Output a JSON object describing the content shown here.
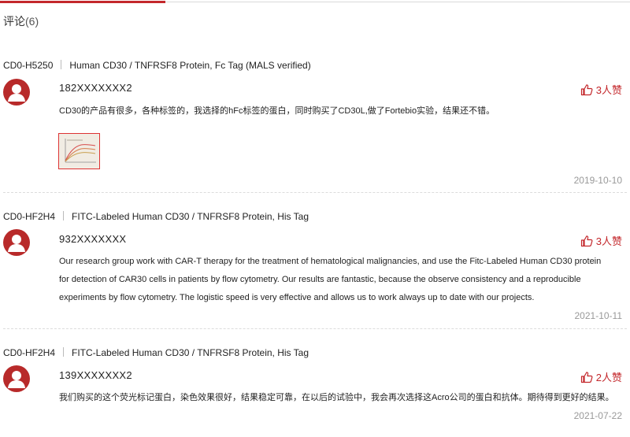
{
  "header": {
    "title": "评论",
    "count": "(6)"
  },
  "reviews": [
    {
      "code": "CD0-H5250",
      "product": "Human CD30 / TNFRSF8 Protein, Fc Tag (MALS verified)",
      "user": "182XXXXXXX2",
      "likes": "3人赞",
      "text": "CD30的产品有很多，各种标签的，我选择的hFc标签的蛋白，同时购买了CD30L,做了Fortebio实验，结果还不错。",
      "date": "2019-10-10"
    },
    {
      "code": "CD0-HF2H4",
      "product": "FITC-Labeled Human CD30 / TNFRSF8 Protein, His Tag",
      "user": "932XXXXXXX",
      "likes": "3人赞",
      "text_lines": [
        "Our research group work with CAR-T therapy for the treatment of hematological malignancies, and use the Fitc-Labeled Human CD30 protein",
        "for detection of CAR30 cells in patients by flow cytometry. Our results are fantastic, because the observe consistency and a reproducible",
        "experiments by flow cytometry. The logistic speed is very effective and allows us to work always up to date with our projects."
      ],
      "date": "2021-10-11"
    },
    {
      "code": "CD0-HF2H4",
      "product": "FITC-Labeled Human CD30 / TNFRSF8 Protein, His Tag",
      "user": "139XXXXXXX2",
      "likes": "2人赞",
      "text": "我们购买的这个荧光标记蛋白，染色效果很好，结果稳定可靠，在以后的试验中，我会再次选择这Acro公司的蛋白和抗体。期待得到更好的结果。",
      "date": "2021-07-22"
    }
  ],
  "colors": {
    "accent": "#c3272b",
    "avatar": "#b82a2a",
    "muted": "#999999"
  },
  "icons": {
    "avatar": "user-avatar-icon",
    "like": "thumbs-up-icon",
    "thumbnail": "chart-image-thumbnail"
  }
}
